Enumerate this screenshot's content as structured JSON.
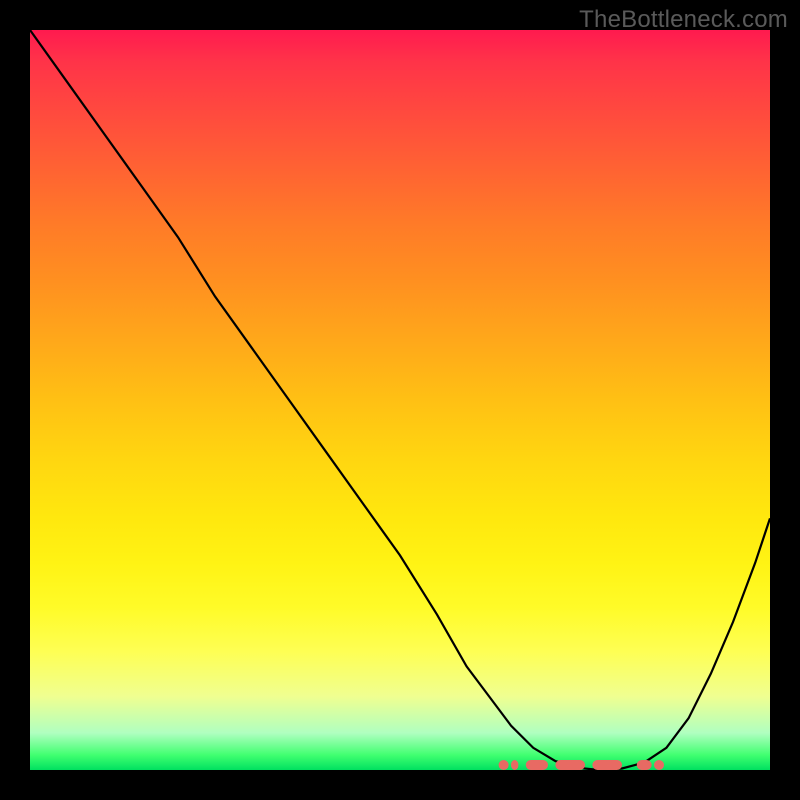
{
  "watermark": "TheBottleneck.com",
  "chart_data": {
    "type": "line",
    "title": "",
    "xlabel": "",
    "ylabel": "",
    "xlim": [
      0,
      100
    ],
    "ylim": [
      0,
      100
    ],
    "series": [
      {
        "name": "bottleneck-curve",
        "x": [
          0,
          5,
          10,
          15,
          20,
          25,
          30,
          35,
          40,
          45,
          50,
          55,
          59,
          62,
          65,
          68,
          71,
          74,
          77,
          80,
          83,
          86,
          89,
          92,
          95,
          98,
          100
        ],
        "y": [
          100,
          93,
          86,
          79,
          72,
          64,
          57,
          50,
          43,
          36,
          29,
          21,
          14,
          10,
          6,
          3,
          1.2,
          0.3,
          0,
          0.2,
          1,
          3,
          7,
          13,
          20,
          28,
          34
        ]
      }
    ],
    "markers": {
      "name": "optimal-band",
      "x_range": [
        65,
        84
      ],
      "y": 0,
      "segments": [
        [
          65,
          66
        ],
        [
          67,
          70
        ],
        [
          71,
          75
        ],
        [
          76,
          80
        ],
        [
          82,
          84
        ]
      ]
    },
    "gradient_stops": [
      {
        "pos": 0,
        "color": "#ff1a4f"
      },
      {
        "pos": 50,
        "color": "#ffc014"
      },
      {
        "pos": 84,
        "color": "#feff54"
      },
      {
        "pos": 100,
        "color": "#00e060"
      }
    ]
  }
}
